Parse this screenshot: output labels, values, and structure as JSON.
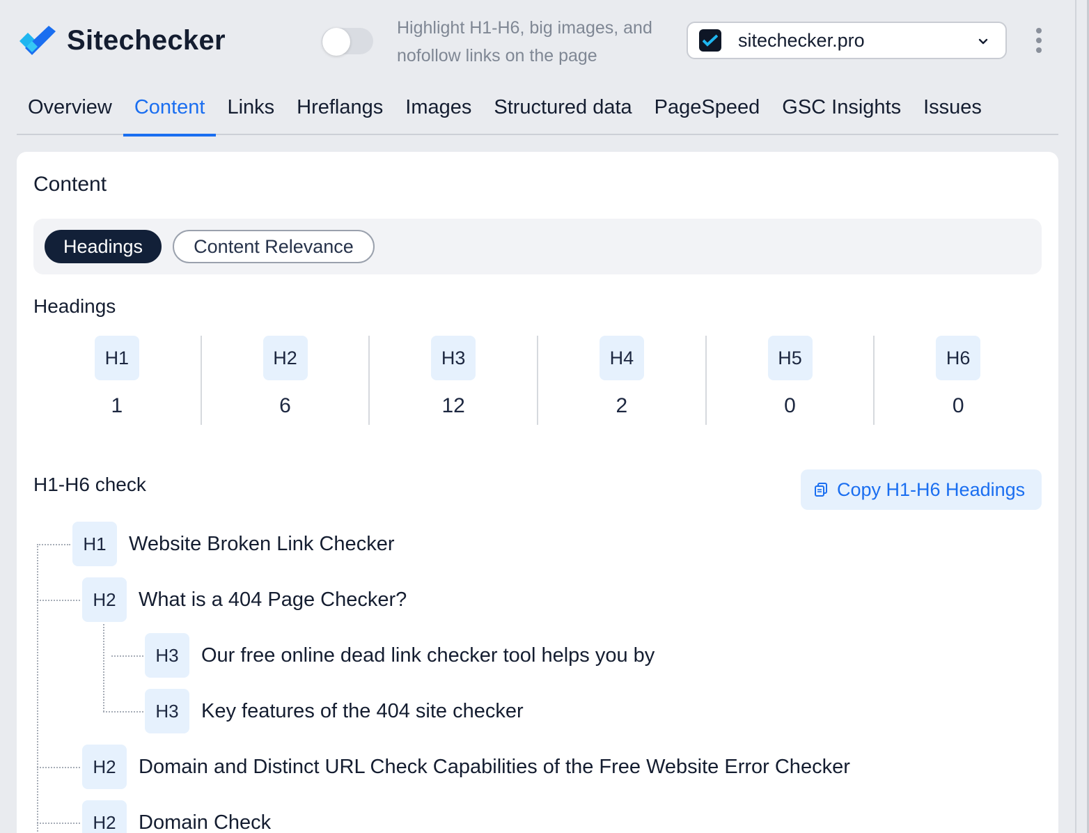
{
  "app": {
    "name": "Sitechecker"
  },
  "header": {
    "highlight_hint": "Highlight H1-H6, big images, and nofollow links on the page",
    "highlight_toggle_on": false,
    "site_selector_value": "sitechecker.pro"
  },
  "tabs": [
    {
      "label": "Overview"
    },
    {
      "label": "Content",
      "active": true
    },
    {
      "label": "Links"
    },
    {
      "label": "Hreflangs"
    },
    {
      "label": "Images"
    },
    {
      "label": "Structured data"
    },
    {
      "label": "PageSpeed"
    },
    {
      "label": "GSC Insights"
    },
    {
      "label": "Issues"
    }
  ],
  "content": {
    "title": "Content",
    "subtabs": [
      {
        "label": "Headings",
        "active": true
      },
      {
        "label": "Content Relevance"
      }
    ],
    "headings_title": "Headings",
    "heading_counts": [
      {
        "tag": "H1",
        "count": "1"
      },
      {
        "tag": "H2",
        "count": "6"
      },
      {
        "tag": "H3",
        "count": "12"
      },
      {
        "tag": "H4",
        "count": "2"
      },
      {
        "tag": "H5",
        "count": "0"
      },
      {
        "tag": "H6",
        "count": "0"
      }
    ],
    "check_title": "H1-H6 check",
    "copy_button_label": "Copy H1-H6 Headings",
    "tree": [
      {
        "tag": "H1",
        "text": "Website Broken Link Checker"
      },
      {
        "tag": "H2",
        "text": "What is a 404 Page Checker?"
      },
      {
        "tag": "H3",
        "text": "Our free online dead link checker tool helps you by"
      },
      {
        "tag": "H3",
        "text": "Key features of the 404 site checker"
      },
      {
        "tag": "H2",
        "text": "Domain and Distinct URL Check Capabilities of the Free Website Error Checker"
      },
      {
        "tag": "H2",
        "text": "Domain Check"
      }
    ]
  },
  "colors": {
    "accent": "#1a6ef0",
    "badge_bg": "#e6f1fd",
    "active_pill": "#122038",
    "page_bg": "#e9ebef"
  }
}
